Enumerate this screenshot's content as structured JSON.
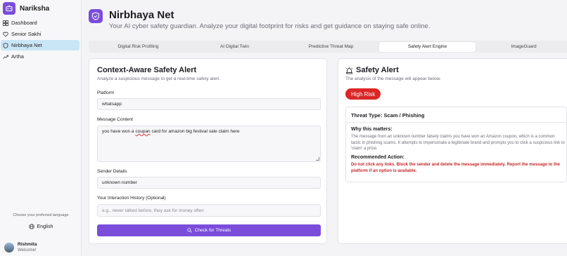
{
  "app": {
    "name": "Nariksha"
  },
  "sidebar": {
    "items": [
      {
        "label": "Dashboard",
        "icon": "grid-icon"
      },
      {
        "label": "Senior Sakhi",
        "icon": "heart-icon"
      },
      {
        "label": "Nirbhaya Net",
        "icon": "shield-icon",
        "active": true
      },
      {
        "label": "Artha",
        "icon": "trend-icon"
      }
    ],
    "language_prompt": "Choose your preferred language",
    "language": "English",
    "user": {
      "name": "Rishmita",
      "subtitle": "Welcome!"
    }
  },
  "header": {
    "title": "Nirbhaya Net",
    "subtitle": "Your AI cyber safety guardian. Analyze your digital footprint for risks and get guidance on staying safe online."
  },
  "tabs": [
    {
      "label": "Digital Risk Profiling"
    },
    {
      "label": "AI Digital Twin"
    },
    {
      "label": "Predictive Threat Map"
    },
    {
      "label": "Safety Alert Engine",
      "active": true
    },
    {
      "label": "ImageGuard"
    }
  ],
  "form": {
    "title": "Context-Aware Safety Alert",
    "description": "Analyze a suspicious message to get a real-time safety alert.",
    "platform_label": "Platform",
    "platform_value": "whatsapp",
    "message_label": "Message Content",
    "message_before": "you have won a ",
    "message_misspelled": "coupan",
    "message_after": " card for amazon big festival sale claim here",
    "sender_label": "Sender Details",
    "sender_value": "unknown number",
    "history_label": "Your Interaction History (Optional)",
    "history_placeholder": "e.g., never talked before, they ask for money often",
    "submit_label": "Check for Threats"
  },
  "alert": {
    "title": "Safety Alert",
    "description": "The analysis of the message will appear below.",
    "risk_level": "High Risk",
    "threat_type": "Threat Type: Scam / Phishing",
    "why_heading": "Why this matters:",
    "why_text": "The message from an unknown number falsely claims you have won an Amazon coupon, which is a common tactic in phishing scams. It attempts to impersonate a legitimate brand and prompts you to click a suspicious link to 'claim' a prize.",
    "recommended_heading": "Recommended Action:",
    "recommended_text": "Do not click any links. Block the sender and delete the message immediately. Report the message to the platform if an option is available."
  },
  "colors": {
    "accent": "#7b4ddb",
    "danger": "#dc2626",
    "active_nav": "#c9e6f7"
  }
}
